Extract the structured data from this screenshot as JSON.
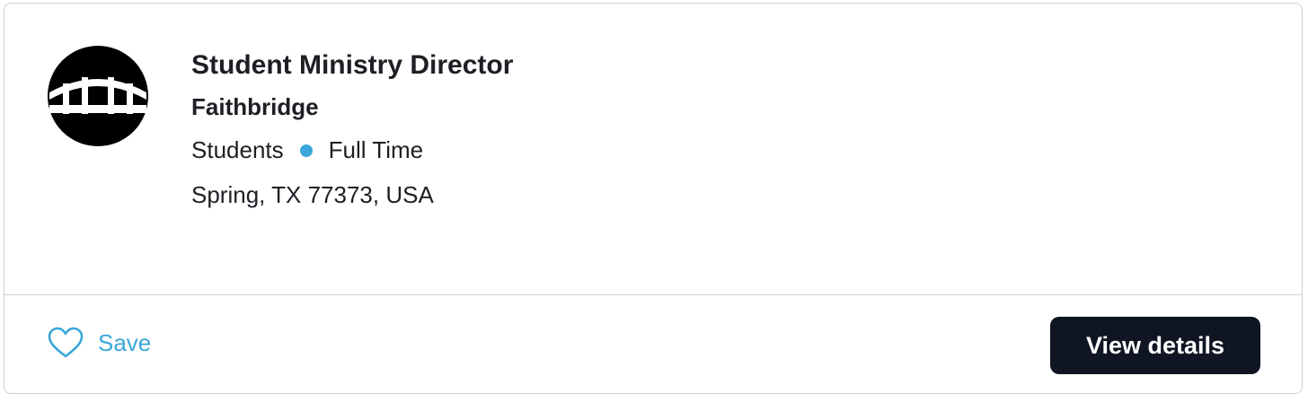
{
  "job": {
    "title": "Student Ministry Director",
    "organization": "Faithbridge",
    "department": "Students",
    "employment_type": "Full Time",
    "location": "Spring, TX 77373, USA"
  },
  "logo": {
    "icon": "faithbridge-bridge-logo"
  },
  "actions": {
    "save_label": "Save",
    "view_details_label": "View details"
  },
  "colors": {
    "accent": "#3aa7d8",
    "button_bg": "#0f1522",
    "text": "#1d1f24",
    "border": "#cfd2d6"
  }
}
